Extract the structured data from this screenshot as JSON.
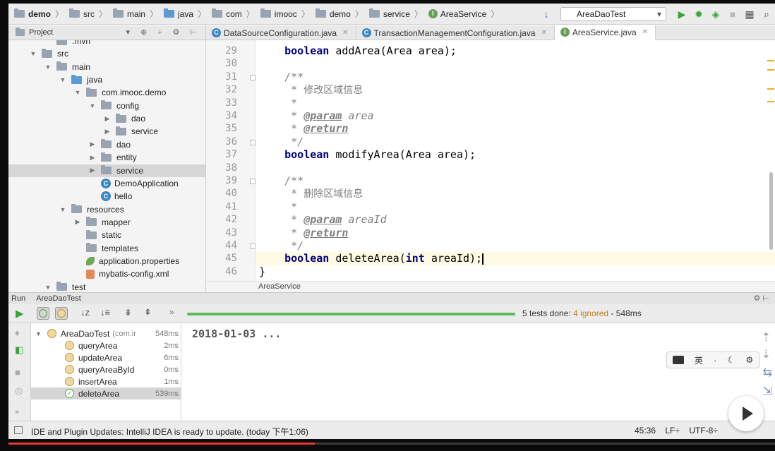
{
  "navbar": {
    "crumbs": [
      "demo",
      "src",
      "main",
      "java",
      "com",
      "imooc",
      "demo",
      "service",
      "AreaService"
    ],
    "run_config": "AreaDaoTest"
  },
  "project": {
    "label": "Project"
  },
  "tabs": [
    {
      "label": "DataSourceConfiguration.java",
      "active": false
    },
    {
      "label": "TransactionManagementConfiguration.java",
      "active": false
    },
    {
      "label": "AreaService.java",
      "active": true
    }
  ],
  "tree": [
    {
      "label": ".mvn",
      "depth": 2,
      "kind": "folder",
      "arrow": ""
    },
    {
      "label": "src",
      "depth": 1,
      "kind": "folder",
      "arrow": "▼"
    },
    {
      "label": "main",
      "depth": 2,
      "kind": "folder",
      "arrow": "▼"
    },
    {
      "label": "java",
      "depth": 3,
      "kind": "folder-blue",
      "arrow": "▼"
    },
    {
      "label": "com.imooc.demo",
      "depth": 4,
      "kind": "folder",
      "arrow": "▼"
    },
    {
      "label": "config",
      "depth": 5,
      "kind": "folder",
      "arrow": "▼"
    },
    {
      "label": "dao",
      "depth": 6,
      "kind": "folder",
      "arrow": "▶"
    },
    {
      "label": "service",
      "depth": 6,
      "kind": "folder",
      "arrow": "▶"
    },
    {
      "label": "dao",
      "depth": 5,
      "kind": "folder",
      "arrow": "▶"
    },
    {
      "label": "entity",
      "depth": 5,
      "kind": "folder",
      "arrow": "▶"
    },
    {
      "label": "service",
      "depth": 5,
      "kind": "folder",
      "arrow": "▶",
      "selected": true
    },
    {
      "label": "DemoApplication",
      "depth": 5,
      "kind": "class",
      "arrow": ""
    },
    {
      "label": "hello",
      "depth": 5,
      "kind": "class",
      "arrow": ""
    },
    {
      "label": "resources",
      "depth": 3,
      "kind": "folder",
      "arrow": "▼"
    },
    {
      "label": "mapper",
      "depth": 4,
      "kind": "folder",
      "arrow": "▶"
    },
    {
      "label": "static",
      "depth": 4,
      "kind": "folder",
      "arrow": ""
    },
    {
      "label": "templates",
      "depth": 4,
      "kind": "folder",
      "arrow": ""
    },
    {
      "label": "application.properties",
      "depth": 4,
      "kind": "leaf",
      "arrow": ""
    },
    {
      "label": "mybatis-config.xml",
      "depth": 4,
      "kind": "xml",
      "arrow": ""
    },
    {
      "label": "test",
      "depth": 2,
      "kind": "folder",
      "arrow": "▼"
    }
  ],
  "editor": {
    "lines": [
      {
        "n": "29",
        "code": [
          [
            "    ",
            ""
          ],
          [
            "boolean",
            "kw"
          ],
          [
            " addArea(Area area);",
            ""
          ]
        ]
      },
      {
        "n": "30",
        "code": []
      },
      {
        "n": "31",
        "code": [
          [
            "    ",
            ""
          ],
          [
            "/**",
            "cm"
          ]
        ]
      },
      {
        "n": "32",
        "code": [
          [
            "     ",
            "cm"
          ],
          [
            "* ",
            "cm"
          ],
          [
            "修改区域信息",
            "cm cjk"
          ]
        ]
      },
      {
        "n": "33",
        "code": [
          [
            "     ",
            "cm"
          ],
          [
            "*",
            "cm"
          ]
        ]
      },
      {
        "n": "34",
        "code": [
          [
            "     ",
            "cm"
          ],
          [
            "* ",
            "cm"
          ],
          [
            "@param",
            "tg"
          ],
          [
            " area",
            "cm"
          ]
        ]
      },
      {
        "n": "35",
        "code": [
          [
            "     ",
            "cm"
          ],
          [
            "* ",
            "cm"
          ],
          [
            "@return",
            "tg"
          ]
        ]
      },
      {
        "n": "36",
        "code": [
          [
            "     ",
            "cm"
          ],
          [
            "*/",
            "cm"
          ]
        ]
      },
      {
        "n": "37",
        "code": [
          [
            "    ",
            ""
          ],
          [
            "boolean",
            "kw"
          ],
          [
            " modifyArea(Area area);",
            ""
          ]
        ]
      },
      {
        "n": "38",
        "code": []
      },
      {
        "n": "39",
        "code": [
          [
            "    ",
            ""
          ],
          [
            "/**",
            "cm"
          ]
        ]
      },
      {
        "n": "40",
        "code": [
          [
            "     ",
            "cm"
          ],
          [
            "* ",
            "cm"
          ],
          [
            "删除区域信息",
            "cm cjk"
          ]
        ]
      },
      {
        "n": "41",
        "code": [
          [
            "     ",
            "cm"
          ],
          [
            "*",
            "cm"
          ]
        ]
      },
      {
        "n": "42",
        "code": [
          [
            "     ",
            "cm"
          ],
          [
            "* ",
            "cm"
          ],
          [
            "@param",
            "tg"
          ],
          [
            " areaId",
            "cm"
          ]
        ]
      },
      {
        "n": "43",
        "code": [
          [
            "     ",
            "cm"
          ],
          [
            "* ",
            "cm"
          ],
          [
            "@return",
            "tg"
          ]
        ]
      },
      {
        "n": "44",
        "code": [
          [
            "     ",
            "cm"
          ],
          [
            "*/",
            "cm"
          ]
        ]
      },
      {
        "n": "45",
        "code": [
          [
            "    ",
            ""
          ],
          [
            "boolean",
            "kw"
          ],
          [
            " deleteArea(",
            ""
          ],
          [
            "int",
            "kw"
          ],
          [
            " areaId);",
            ""
          ]
        ]
      },
      {
        "n": "46",
        "code": [
          [
            "}",
            ""
          ]
        ]
      }
    ],
    "breadcrumb": "AreaService"
  },
  "run": {
    "title": "Run",
    "config": "AreaDaoTest",
    "progress": 1.0,
    "summary_done": "5 tests done:",
    "summary_ignored": "4 ignored",
    "summary_time": "- 548ms",
    "tests": [
      {
        "name": "AreaDaoTest",
        "suffix": "(com.ir",
        "time": "548ms",
        "status": "ignored",
        "root": true
      },
      {
        "name": "queryArea",
        "time": "2ms",
        "status": "ignored"
      },
      {
        "name": "updateArea",
        "time": "6ms",
        "status": "ignored"
      },
      {
        "name": "queryAreaById",
        "time": "0ms",
        "status": "ignored"
      },
      {
        "name": "insertArea",
        "time": "1ms",
        "status": "ignored"
      },
      {
        "name": "deleteArea",
        "time": "539ms",
        "status": "passed",
        "selected": true
      }
    ],
    "console_output": "2018-01-03 ..."
  },
  "ime": {
    "lang": "英"
  },
  "status": {
    "message": "IDE and Plugin Updates: IntelliJ IDEA is ready to update. (today 下午1:06)",
    "position": "45:36",
    "line_sep": "LF÷",
    "encoding": "UTF-8÷"
  },
  "video": {
    "progress": 0.4
  },
  "colors": {
    "keyword": "#000080",
    "comment": "#808080",
    "progress_green": "#5fb85f",
    "ignored_orange": "#c47f16",
    "current_line": "#fffae3"
  }
}
